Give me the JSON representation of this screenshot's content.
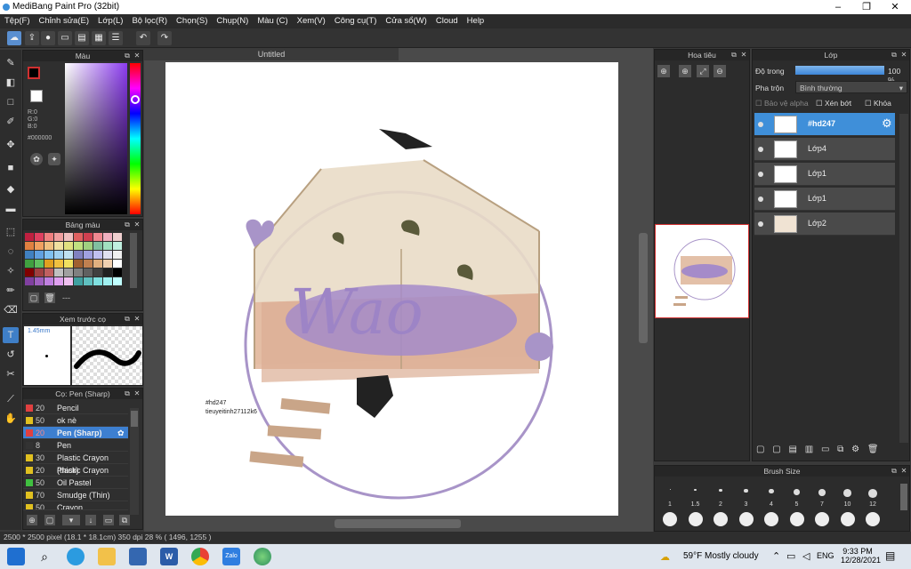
{
  "app": {
    "title": "MediBang Paint Pro (32bit)"
  },
  "menu": [
    "Tệp(F)",
    "Chỉnh sửa(E)",
    "Lớp(L)",
    "Bộ lọc(R)",
    "Chọn(S)",
    "Chụp(N)",
    "Màu (C)",
    "Xem(V)",
    "Công cụ(T)",
    "Cửa sổ(W)",
    "Cloud",
    "Help"
  ],
  "canvas": {
    "tab": "Untitled",
    "watermark1": "#hd247",
    "watermark2": "tieuyeitinh27112k6",
    "art_text": "Wao"
  },
  "color_panel": {
    "title": "Màu",
    "r": "R:0",
    "g": "G:0",
    "b": "B:0",
    "hex": "#000000"
  },
  "palette_panel": {
    "title": "Bảng màu",
    "more": "---"
  },
  "preview_panel": {
    "title": "Xem trước cọ",
    "size": "1.45mm"
  },
  "brush_panel": {
    "title": "Cọ: Pen (Sharp)",
    "items": [
      {
        "size": "20",
        "name": "Pencil",
        "color": "#e04040"
      },
      {
        "size": "50",
        "name": "ok nè",
        "color": "#e0c020"
      },
      {
        "size": "20",
        "name": "Pen (Sharp)",
        "color": "#e04040",
        "selected": true
      },
      {
        "size": "8",
        "name": "Pen",
        "color": "#333333"
      },
      {
        "size": "30",
        "name": "Plastic Crayon (thick)",
        "color": "#e0c020"
      },
      {
        "size": "20",
        "name": "Plastic Crayon",
        "color": "#e0c020"
      },
      {
        "size": "50",
        "name": "Oil Pastel",
        "color": "#40c040"
      },
      {
        "size": "70",
        "name": "Smudge (Thin)",
        "color": "#e0c020"
      },
      {
        "size": "50",
        "name": "Crayon",
        "color": "#e0c020"
      }
    ]
  },
  "navigator": {
    "title": "Hoa tiêu"
  },
  "layer_panel": {
    "title": "Lớp",
    "opacity_label": "Độ trong",
    "opacity_value": "100 %",
    "opacity": 1.0,
    "blend_label": "Pha trộn",
    "blend_value": "Bình thường",
    "protect_alpha": "Bảo vệ alpha",
    "clipping": "Xén bớt",
    "lock": "Khóa",
    "layers": [
      {
        "name": "#hd247",
        "selected": true
      },
      {
        "name": "Lớp4"
      },
      {
        "name": "Lớp1"
      },
      {
        "name": "Lớp1"
      },
      {
        "name": "Lớp2"
      }
    ]
  },
  "brush_size_panel": {
    "title": "Brush Size",
    "sizes": [
      "1",
      "1.5",
      "2",
      "3",
      "4",
      "5",
      "7",
      "10",
      "12"
    ]
  },
  "status": {
    "text": "2500 * 2500 pixel  (18.1 * 18.1cm)  350 dpi  28 %  ( 1496, 1255 )"
  },
  "taskbar": {
    "weather": "59°F  Mostly cloudy",
    "lang": "ENG",
    "time": "9:33 PM",
    "date": "12/28/2021"
  }
}
